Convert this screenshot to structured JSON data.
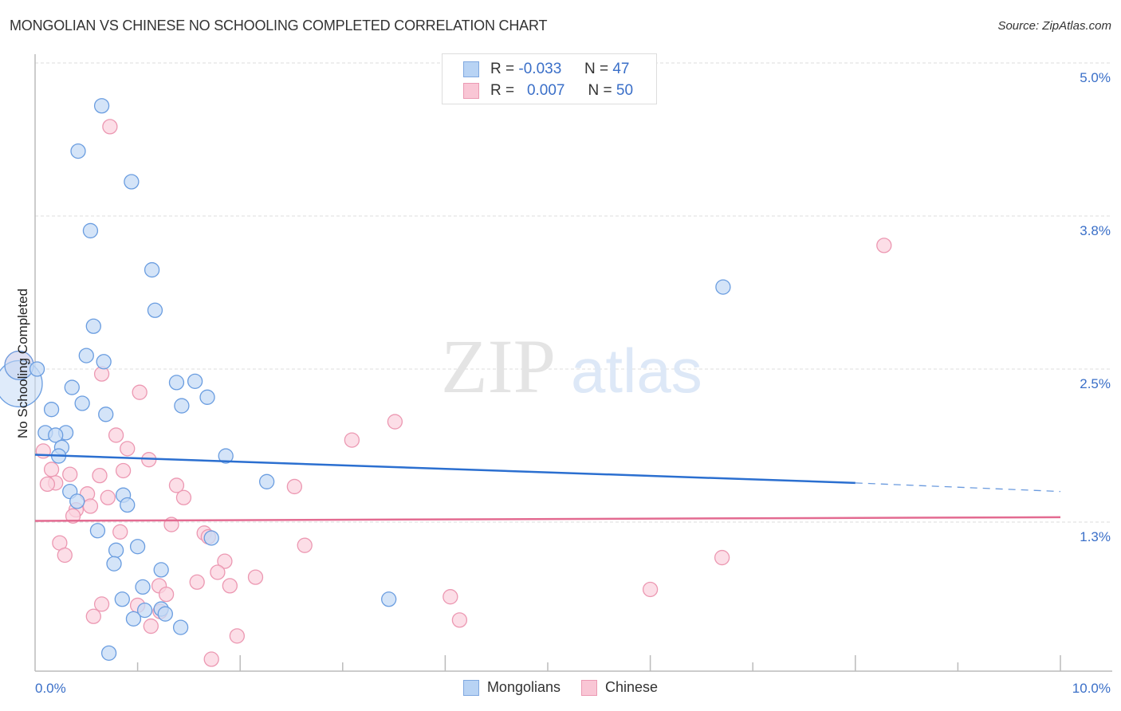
{
  "title": "MONGOLIAN VS CHINESE NO SCHOOLING COMPLETED CORRELATION CHART",
  "source": "Source: ZipAtlas.com",
  "watermark": {
    "zip": "ZIP",
    "atlas": "atlas"
  },
  "legend_stats": [
    {
      "swatch_color": "#b8d3f4",
      "r_label": "R =",
      "r_value": "-0.033",
      "n_label": "N =",
      "n_value": "47"
    },
    {
      "swatch_color": "#f9c6d5",
      "r_label": "R =",
      "r_value": "0.007",
      "n_label": "N =",
      "n_value": "50"
    }
  ],
  "bottom_legend": [
    {
      "label": "Mongolians",
      "color": "#b8d3f4"
    },
    {
      "label": "Chinese",
      "color": "#f9c6d5"
    }
  ],
  "chart_data": {
    "type": "scatter",
    "title": "MONGOLIAN VS CHINESE NO SCHOOLING COMPLETED CORRELATION CHART",
    "xlabel": "",
    "ylabel": "No Schooling Completed",
    "xlim": [
      0,
      10
    ],
    "ylim": [
      0.03,
      5.1
    ],
    "x_tick_labels": [
      "0.0%",
      "10.0%"
    ],
    "y_ticks": [
      5.0,
      3.75,
      2.5,
      1.25
    ],
    "y_tick_labels": [
      "5.0%",
      "3.8%",
      "2.5%",
      "1.3%"
    ],
    "grid": true,
    "legend": "top-center",
    "series": [
      {
        "name": "Mongolians",
        "color": "#6a9de0",
        "fill": "#c5dbf6",
        "line_color": "#2b6fd0",
        "r": -0.033,
        "n": 47,
        "trend": {
          "x0": 0.0,
          "y0": 1.8,
          "x1": 8.0,
          "y1": 1.57,
          "dash_to_x": 10.0,
          "dash_y": 1.5
        },
        "points": [
          [
            0.65,
            4.65
          ],
          [
            0.42,
            4.28
          ],
          [
            0.94,
            4.03
          ],
          [
            0.54,
            3.63
          ],
          [
            1.14,
            3.31
          ],
          [
            1.17,
            2.98
          ],
          [
            0.57,
            2.85
          ],
          [
            0.5,
            2.61
          ],
          [
            0.67,
            2.56
          ],
          [
            0.36,
            2.35
          ],
          [
            1.38,
            2.39
          ],
          [
            1.56,
            2.4
          ],
          [
            0.16,
            2.17
          ],
          [
            0.46,
            2.22
          ],
          [
            1.43,
            2.2
          ],
          [
            0.69,
            2.13
          ],
          [
            1.68,
            2.27
          ],
          [
            0.1,
            1.98
          ],
          [
            0.3,
            1.98
          ],
          [
            0.2,
            1.96
          ],
          [
            0.26,
            1.86
          ],
          [
            0.23,
            1.79
          ],
          [
            1.86,
            1.79
          ],
          [
            2.26,
            1.58
          ],
          [
            0.34,
            1.5
          ],
          [
            0.86,
            1.47
          ],
          [
            0.41,
            1.42
          ],
          [
            0.9,
            1.39
          ],
          [
            0.61,
            1.18
          ],
          [
            1.72,
            1.12
          ],
          [
            0.79,
            1.02
          ],
          [
            1.0,
            1.05
          ],
          [
            0.77,
            0.91
          ],
          [
            1.23,
            0.86
          ],
          [
            1.05,
            0.72
          ],
          [
            0.85,
            0.62
          ],
          [
            3.45,
            0.62
          ],
          [
            1.07,
            0.53
          ],
          [
            1.23,
            0.54
          ],
          [
            0.96,
            0.46
          ],
          [
            1.27,
            0.5
          ],
          [
            1.42,
            0.39
          ],
          [
            0.72,
            0.18
          ],
          [
            6.71,
            3.17
          ],
          [
            0.0,
            2.38
          ],
          [
            0.0,
            2.53
          ],
          [
            0.02,
            2.5
          ]
        ],
        "large_points": [
          [
            0.0,
            2.38
          ],
          [
            0.0,
            2.53
          ]
        ]
      },
      {
        "name": "Chinese",
        "color": "#ec98b2",
        "fill": "#fbd3df",
        "line_color": "#e36b91",
        "r": 0.007,
        "n": 50,
        "trend": {
          "x0": 0.0,
          "y0": 1.26,
          "x1": 10.0,
          "y1": 1.29
        },
        "points": [
          [
            0.73,
            4.48
          ],
          [
            8.28,
            3.51
          ],
          [
            0.65,
            2.46
          ],
          [
            1.02,
            2.31
          ],
          [
            3.51,
            2.07
          ],
          [
            3.09,
            1.92
          ],
          [
            0.79,
            1.96
          ],
          [
            0.9,
            1.85
          ],
          [
            1.11,
            1.76
          ],
          [
            0.16,
            1.68
          ],
          [
            0.08,
            1.83
          ],
          [
            0.34,
            1.64
          ],
          [
            0.63,
            1.63
          ],
          [
            0.86,
            1.67
          ],
          [
            0.2,
            1.57
          ],
          [
            0.12,
            1.56
          ],
          [
            1.38,
            1.55
          ],
          [
            2.53,
            1.54
          ],
          [
            0.51,
            1.48
          ],
          [
            0.71,
            1.45
          ],
          [
            0.54,
            1.38
          ],
          [
            1.45,
            1.45
          ],
          [
            0.4,
            1.35
          ],
          [
            0.37,
            1.3
          ],
          [
            1.33,
            1.23
          ],
          [
            0.83,
            1.17
          ],
          [
            1.65,
            1.16
          ],
          [
            1.69,
            1.13
          ],
          [
            0.24,
            1.08
          ],
          [
            2.63,
            1.06
          ],
          [
            0.29,
            0.98
          ],
          [
            6.7,
            0.96
          ],
          [
            1.85,
            0.93
          ],
          [
            1.78,
            0.84
          ],
          [
            2.15,
            0.8
          ],
          [
            1.21,
            0.73
          ],
          [
            1.58,
            0.76
          ],
          [
            1.9,
            0.73
          ],
          [
            1.28,
            0.66
          ],
          [
            6.0,
            0.7
          ],
          [
            0.65,
            0.58
          ],
          [
            1.0,
            0.57
          ],
          [
            4.05,
            0.64
          ],
          [
            0.57,
            0.48
          ],
          [
            1.22,
            0.52
          ],
          [
            1.13,
            0.4
          ],
          [
            4.14,
            0.45
          ],
          [
            1.97,
            0.32
          ],
          [
            1.72,
            0.13
          ],
          [
            0.0,
            2.53
          ]
        ],
        "large_points": [
          [
            0.0,
            2.53
          ]
        ]
      }
    ]
  }
}
